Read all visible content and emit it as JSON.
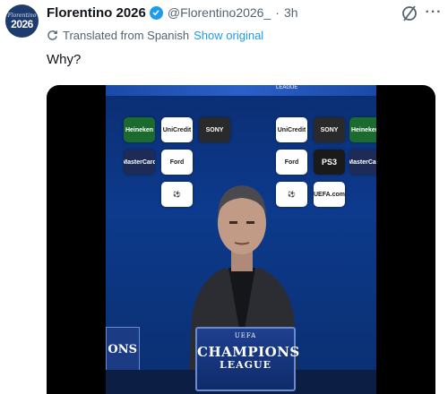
{
  "account": {
    "avatar_line1": "Florentino",
    "avatar_line2": "2026",
    "name": "Florentino 2026",
    "handle": "@Florentino2026_",
    "separator": "·",
    "time": "3h"
  },
  "translation": {
    "label": "Translated from Spanish",
    "show_original": "Show original"
  },
  "tweet": {
    "text": "Why?"
  },
  "media": {
    "league_top": "LEAGUE",
    "sponsors": [
      {
        "text": "Heineken",
        "style": "heineken"
      },
      {
        "text": "UniCredit",
        "style": "plain"
      },
      {
        "text": "SONY",
        "style": "sony"
      },
      {
        "text": "UniCredit",
        "style": "plain"
      },
      {
        "text": "SONY",
        "style": "sony"
      },
      {
        "text": "Heineken",
        "style": "heineken"
      },
      {
        "text": "MasterCard",
        "style": "mc"
      },
      {
        "text": "Ford",
        "style": "plain"
      },
      {
        "text": "Ford",
        "style": "plain"
      },
      {
        "text": "PS3",
        "style": "ps3"
      },
      {
        "text": "MasterCard",
        "style": "mc"
      },
      {
        "text": "⚽",
        "style": "plain"
      },
      {
        "text": "⚽",
        "style": "plain"
      },
      {
        "text": "UEFA.com",
        "style": "plain"
      }
    ],
    "podium_uefa": "UEFA",
    "podium_champions": "CHAMPIONS",
    "podium_league": "LEAGUE",
    "side_sign": "ONS"
  },
  "colors": {
    "link": "#1d9bf0",
    "secondary_text": "#536471",
    "verified": "#1d9bf0"
  },
  "icons": [
    "verified-badge-icon",
    "grok-icon",
    "more-icon",
    "translate-icon"
  ]
}
